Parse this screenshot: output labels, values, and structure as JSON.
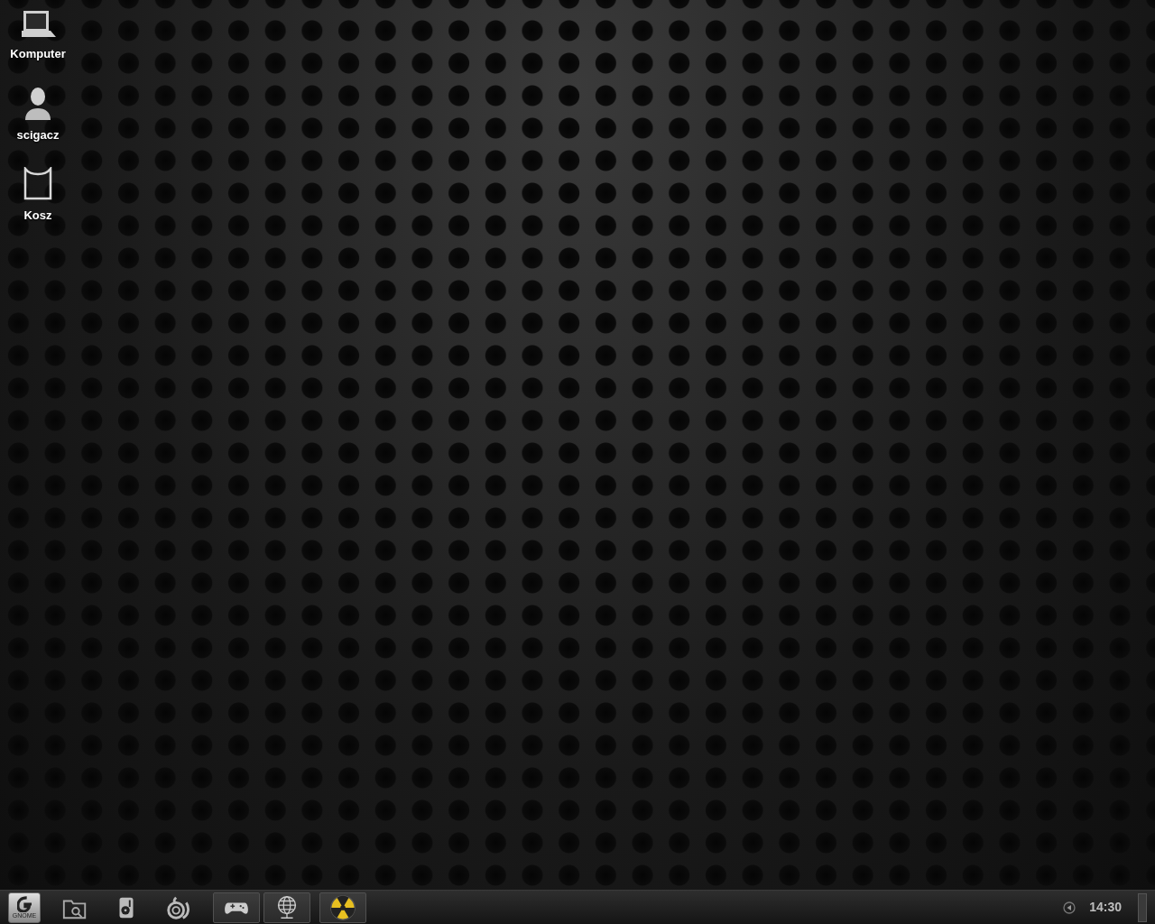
{
  "desktop_icons": [
    {
      "kind": "computer",
      "label": "Komputer"
    },
    {
      "kind": "user",
      "label": "scigacz"
    },
    {
      "kind": "trash",
      "label": "Kosz"
    }
  ],
  "taskbar": {
    "menu_button": {
      "label": "GNOME"
    },
    "items": [
      {
        "kind": "launcher"
      },
      {
        "kind": "launcher"
      },
      {
        "kind": "launcher"
      },
      {
        "kind": "task"
      },
      {
        "kind": "task"
      },
      {
        "kind": "task"
      }
    ],
    "clock": "14:30"
  }
}
